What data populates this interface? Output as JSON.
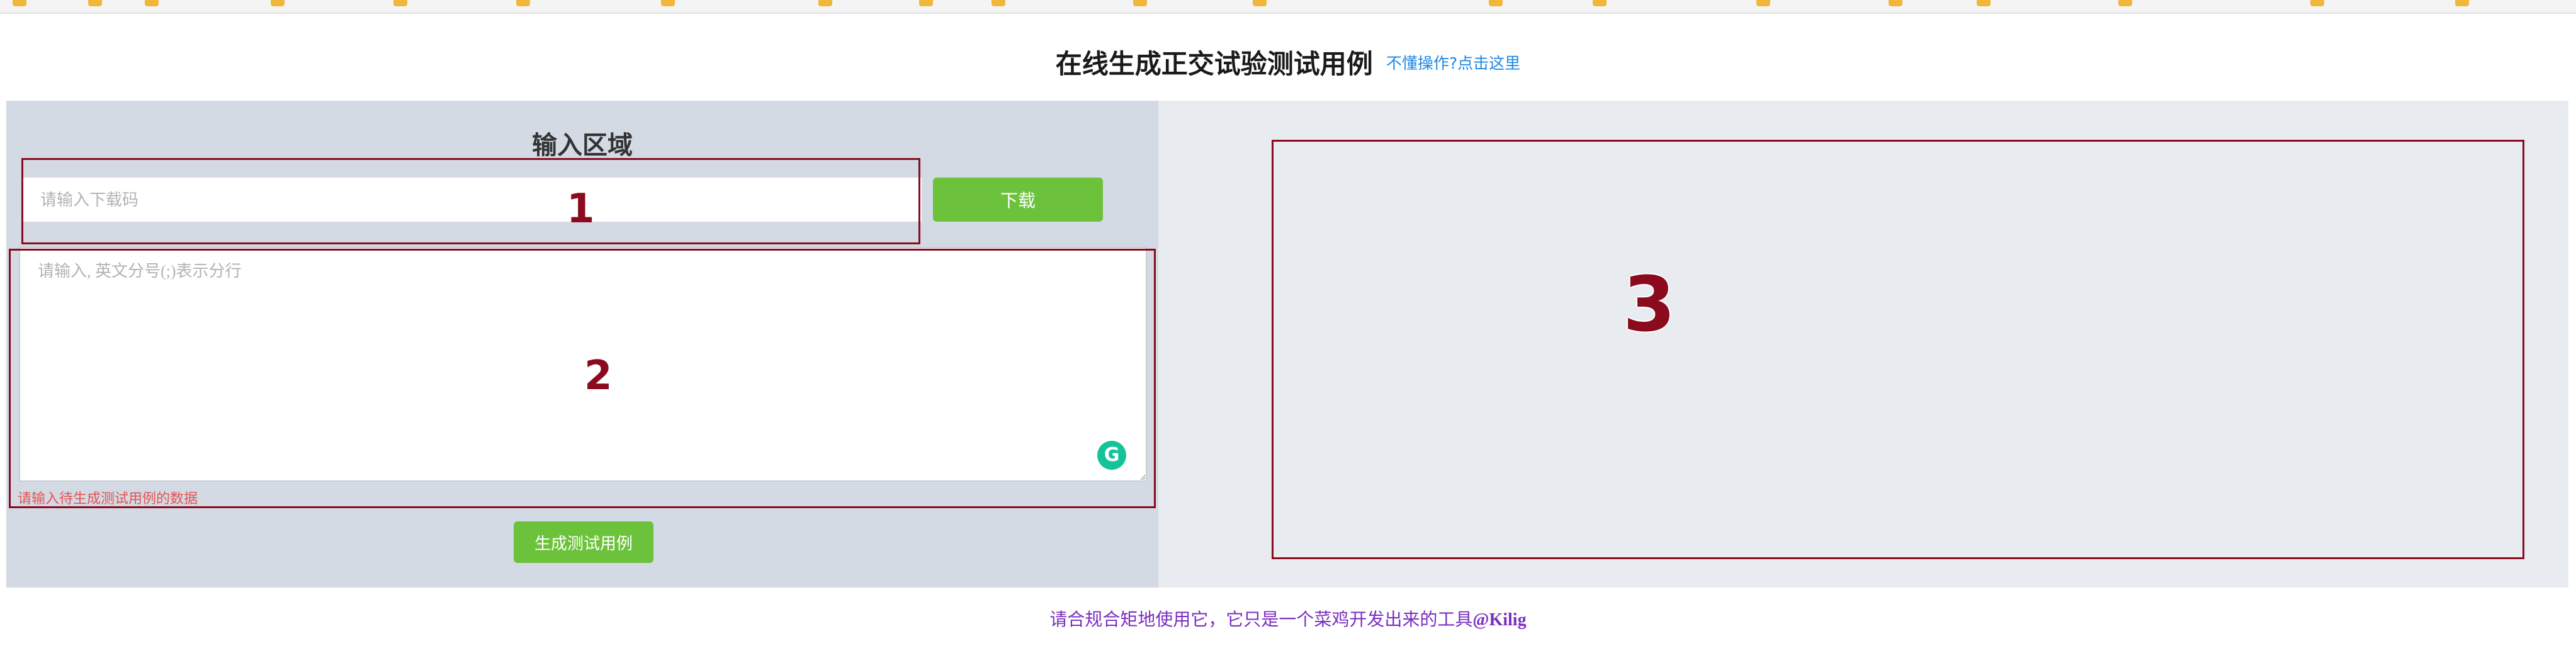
{
  "header": {
    "title": "在线生成正交试验测试用例",
    "help_link": "不懂操作?点击这里"
  },
  "input_panel": {
    "title": "输入区域",
    "code_placeholder": "请输入下载码",
    "download_label": "下载",
    "textarea_placeholder": "请输入, 英文分号(;)表示分行",
    "error_message": "请输入待生成测试用例的数据",
    "generate_label": "生成测试用例",
    "grammarly_glyph": "G"
  },
  "annotations": {
    "label_1": "1",
    "label_2": "2",
    "label_3": "3",
    "color": "#8b0a1e"
  },
  "footer": {
    "text": "请合规合矩地使用它，它只是一个菜鸡开发出来的工具",
    "author": "@Kilig"
  },
  "colors": {
    "accent_green": "#6cc23b",
    "link_blue": "#1e88e5",
    "error_red": "#e55353",
    "footer_purple": "#7a2fc2",
    "left_panel_bg": "#d3dae4",
    "right_panel_bg": "#e8ecf1"
  }
}
